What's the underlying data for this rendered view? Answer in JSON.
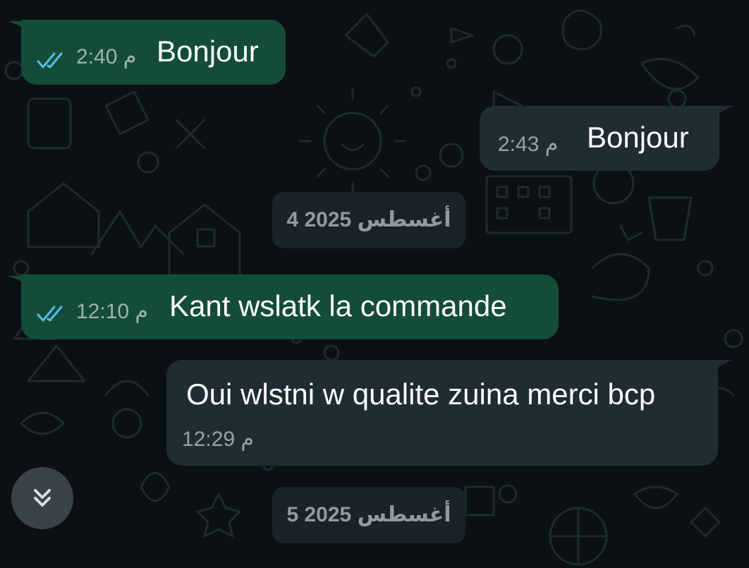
{
  "messages": [
    {
      "direction": "sent",
      "text": "Bonjour",
      "time": "2:40 م",
      "status": "read"
    },
    {
      "direction": "received",
      "text": "Bonjour",
      "time": "2:43 م"
    },
    {
      "direction": "sent",
      "text": "Kant wslatk la commande",
      "time": "12:10 م",
      "status": "read"
    },
    {
      "direction": "received",
      "text": "Oui wlstni w qualite zuina merci bcp",
      "time": "12:29 م"
    }
  ],
  "date_separators": [
    {
      "label": "4 أغسطس 2025"
    },
    {
      "label": "5 أغسطس 2025"
    }
  ],
  "icons": {
    "read_receipt": "double-check-icon",
    "scroll_down": "chevron-double-down-icon"
  },
  "colors": {
    "background": "#0b1014",
    "sent_bubble": "#144d37",
    "received_bubble": "#1f2c33",
    "date_pill": "#1a2328",
    "read_tick": "#53bdeb",
    "meta_text": "#9fb2ad"
  }
}
